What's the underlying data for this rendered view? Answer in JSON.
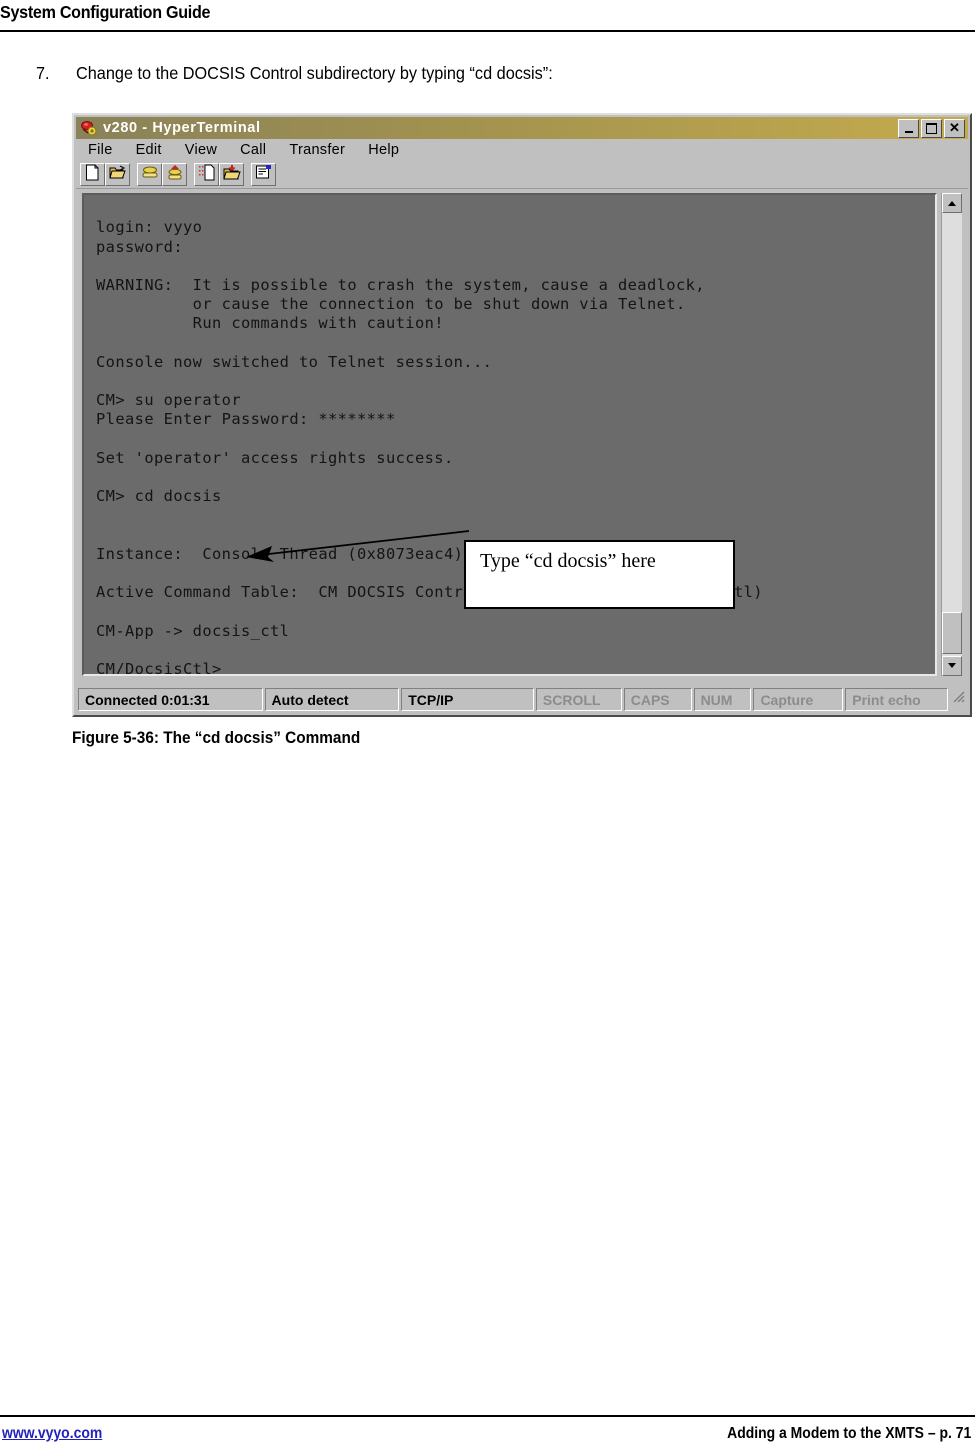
{
  "document": {
    "header_title": "System Configuration Guide",
    "step": {
      "number": "7.",
      "text": "Change to the DOCSIS Control subdirectory by typing “cd docsis”:"
    },
    "figure_caption": "Figure 5-36: The “cd docsis” Command",
    "footer": {
      "link": "www.vyyo.com",
      "page_label": "Adding a Modem to the XMTS – p. 71"
    }
  },
  "terminal_window": {
    "title": "v280 - HyperTerminal",
    "window_icon": "modem-phone-icon",
    "window_buttons": {
      "minimize": "minimize-icon",
      "maximize": "maximize-icon",
      "close": "✕"
    },
    "menu": [
      {
        "label": "File"
      },
      {
        "label": "Edit"
      },
      {
        "label": "View"
      },
      {
        "label": "Call"
      },
      {
        "label": "Transfer"
      },
      {
        "label": "Help"
      }
    ],
    "toolbar": [
      {
        "name": "new-connection-icon"
      },
      {
        "name": "open-connection-icon"
      },
      {
        "name": "call-icon"
      },
      {
        "name": "disconnect-icon"
      },
      {
        "name": "send-file-icon"
      },
      {
        "name": "receive-file-icon"
      },
      {
        "name": "properties-icon"
      }
    ],
    "screen_text": "login: vyyo\npassword:\n\nWARNING:  It is possible to crash the system, cause a deadlock,\n          or cause the connection to be shut down via Telnet.\n          Run commands with caution!\n\nConsole now switched to Telnet session...\n\nCM> su operator\nPlease Enter Password: ********\n\nSet 'operator' access rights success.\n\nCM> cd docsis\n\n\nInstance:  Console Thread (0x8073eac4)\n\nActive Command Table:  CM DOCSIS Control Thread Commands (docsis_ctl)\n\nCM-App -> docsis_ctl\n\nCM/DocsisCtl>",
    "callout": {
      "text": "Type “cd docsis” here"
    },
    "status_bar": [
      {
        "label": "Connected 0:01:31",
        "dim": false
      },
      {
        "label": "Auto detect",
        "dim": false
      },
      {
        "label": "TCP/IP",
        "dim": false
      },
      {
        "label": "SCROLL",
        "dim": true
      },
      {
        "label": "CAPS",
        "dim": true
      },
      {
        "label": "NUM",
        "dim": true
      },
      {
        "label": "Capture",
        "dim": true
      },
      {
        "label": "Print echo",
        "dim": true
      }
    ]
  },
  "colors": {
    "titlebar_left": "#8a8258",
    "titlebar_right": "#c5ab4e",
    "window_face": "#c0c0c0",
    "terminal_bg": "#6b6b6b",
    "terminal_fg": "#141414",
    "link": "#2222bb"
  }
}
